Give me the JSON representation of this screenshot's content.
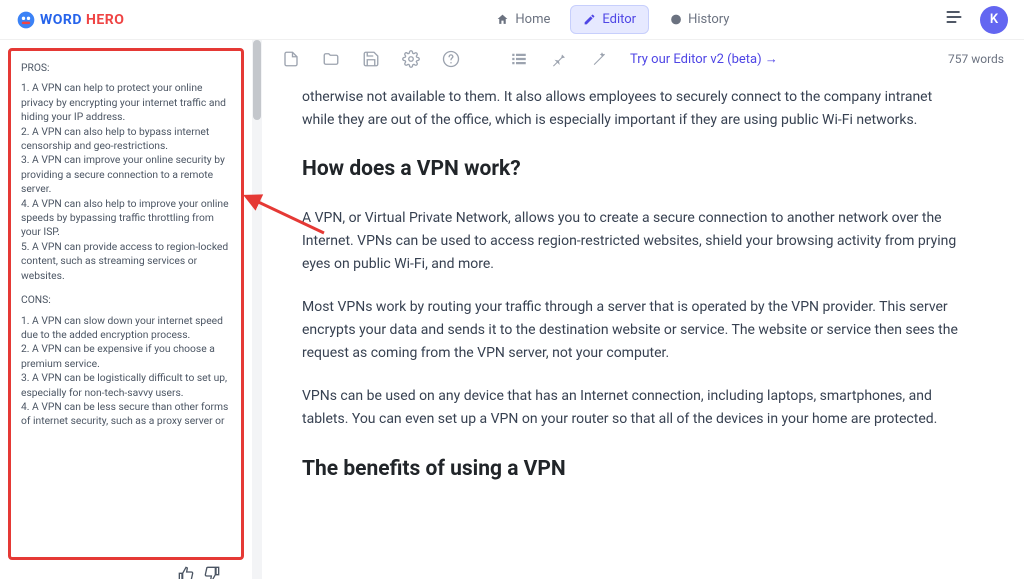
{
  "brand": {
    "word": "WORD",
    "hero": "HERO"
  },
  "nav": {
    "home": "Home",
    "editor": "Editor",
    "history": "History"
  },
  "avatar_initial": "K",
  "sidebar": {
    "pros_label": "PROS:",
    "pros": [
      "1. A VPN can help to protect your online privacy by encrypting your internet traffic and hiding your IP address.",
      "2. A VPN can also help to bypass internet censorship and geo-restrictions.",
      "3. A VPN can improve your online security by providing a secure connection to a remote server.",
      "4. A VPN can also help to improve your online speeds by bypassing traffic throttling from your ISP.",
      "5. A VPN can provide access to region-locked content, such as streaming services or websites."
    ],
    "cons_label": "CONS:",
    "cons": [
      "1. A VPN can slow down your internet speed due to the added encryption process.",
      "2. A VPN can be expensive if you choose a premium service.",
      "3. A VPN can be logistically difficult to set up, especially for non-tech-savvy users.",
      "4. A VPN can be less secure than other forms of internet security, such as a proxy server or"
    ]
  },
  "toolbar": {
    "try_link": "Try our Editor v2 (beta) →",
    "wordcount": "757 words"
  },
  "article": {
    "lead": "otherwise not available to them. It also allows employees to securely connect to the company intranet while they are out of the office, which is especially important if they are using public Wi-Fi networks.",
    "h1": "How does a VPN work?",
    "p1": "A VPN, or Virtual Private Network, allows you to create a secure connection to another network over the Internet. VPNs can be used to access region-restricted websites, shield your browsing activity from prying eyes on public Wi-Fi, and more.",
    "p2": "Most VPNs work by routing your traffic through a server that is operated by the VPN provider. This server encrypts your data and sends it to the destination website or service. The website or service then sees the request as coming from the VPN server, not your computer.",
    "p3": "VPNs can be used on any device that has an Internet connection, including laptops, smartphones, and tablets. You can even set up a VPN on your router so that all of the devices in your home are protected.",
    "h2": "The benefits of using a VPN"
  }
}
